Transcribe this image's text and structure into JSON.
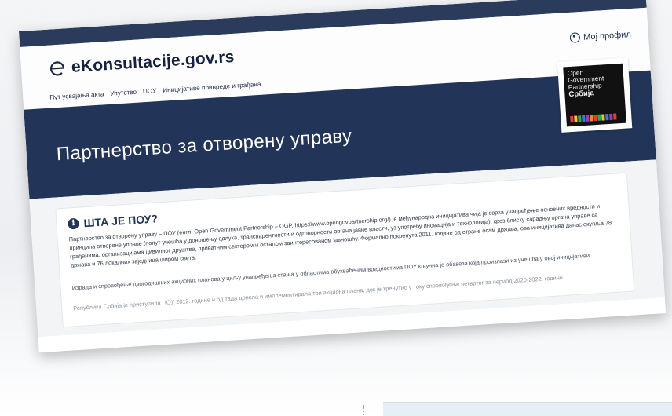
{
  "site": {
    "name": "eKonsultacije.gov.rs"
  },
  "header": {
    "profile_label": "Мој профил",
    "nav": [
      "Пут усвајања акта",
      "Упутство",
      "ПОУ",
      "Иницијативе привреде и грађана"
    ]
  },
  "hero": {
    "title": "Партнерство за отворену управу",
    "badge_lines": [
      "Open",
      "Government",
      "Partnership",
      "Србија"
    ]
  },
  "section": {
    "title": "ШТА ЈЕ ПОУ?",
    "paragraphs": [
      "Партнерство за отворену управу – ПОУ (енгл. Open Government Partnership – OGP, https://www.opengovpartnership.org/) је међународна иницијатива чија је сврха унапређење основних вредности и принципа отворене управе (попут учешћа у доношењу одлука, транспарентности и одговорности органа јавне власти, уз употребу иновација и технологија), кроз блиску сарадњу органа управе са грађанима, организацијама цивилног друштва, приватним сектором и осталом заинтересованом јавношћу. Формално покренута 2011. године од стране осам држава, ова иницијатива данас окупља 78 држава и 76 локалних заједница широм света.",
      "Израда и спровођење двогодишњих акционих планова у циљу унапређења стања у областима обухваћеним вредностима ПОУ кључна је обавеза која произлази из учешћа у овој иницијативи.",
      "Република Србија је приступила ПОУ 2012. године и од тада донела и имплементирала три акциона плана, док је тренутно у току спровођење четвртог за период 2020-2022. године."
    ]
  },
  "colors": {
    "navy": "#223458",
    "dark_header": "#2b3b5b"
  }
}
